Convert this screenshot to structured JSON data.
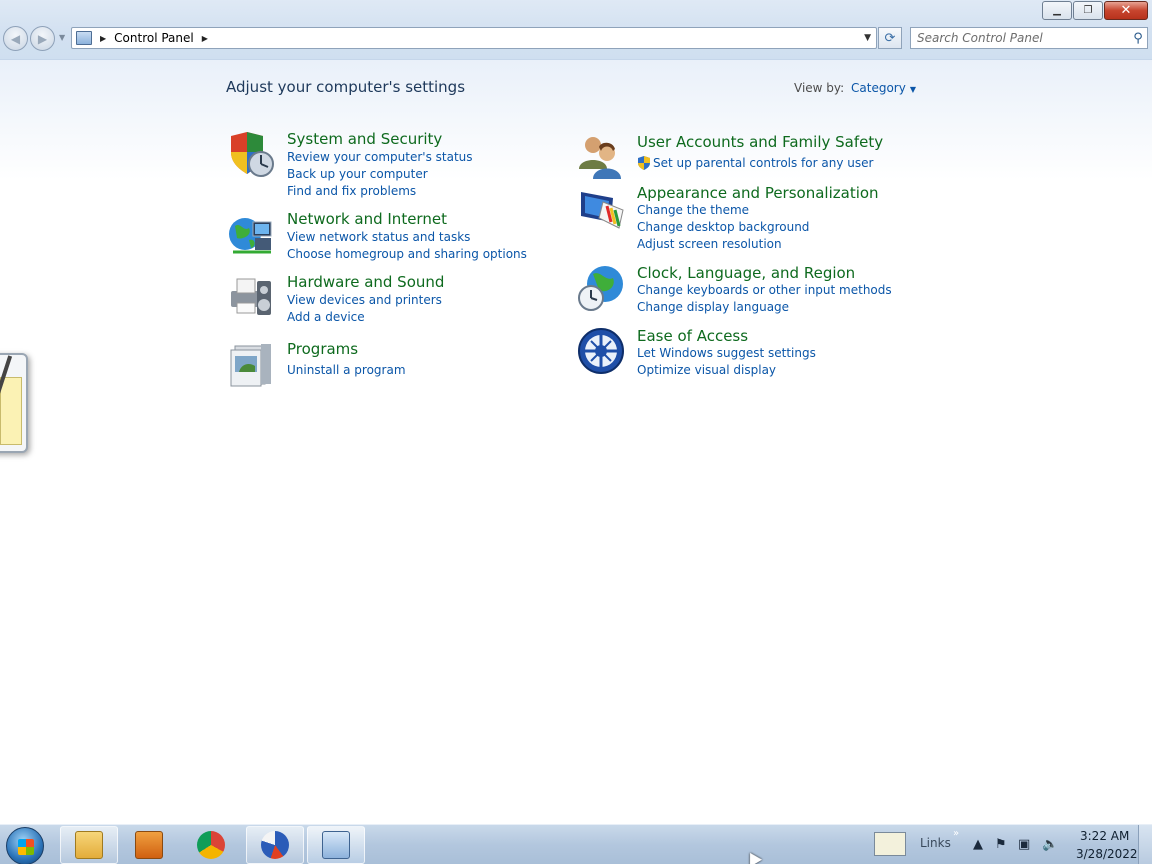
{
  "window": {
    "minimize_icon": "minimize-icon",
    "restore_icon": "restore-icon",
    "close_icon": "close-icon"
  },
  "address_bar": {
    "root_icon": "control-panel-icon",
    "path": "Control Panel"
  },
  "search": {
    "placeholder": "Search Control Panel"
  },
  "page": {
    "title": "Adjust your computer's settings",
    "view_by_label": "View by:",
    "view_by_value": "Category"
  },
  "categories": [
    {
      "title": "System and Security",
      "icon": "shield-clock-icon",
      "links": [
        "Review your computer's status",
        "Back up your computer",
        "Find and fix problems"
      ]
    },
    {
      "title": "Network and Internet",
      "icon": "globe-network-icon",
      "links": [
        "View network status and tasks",
        "Choose homegroup and sharing options"
      ]
    },
    {
      "title": "Hardware and Sound",
      "icon": "printer-speaker-icon",
      "links": [
        "View devices and printers",
        "Add a device"
      ]
    },
    {
      "title": "Programs",
      "icon": "programs-icon",
      "links": [
        "Uninstall a program"
      ]
    },
    {
      "title": "User Accounts and Family Safety",
      "icon": "users-icon",
      "links": [
        "Set up parental controls for any user"
      ]
    },
    {
      "title": "Appearance and Personalization",
      "icon": "display-brush-icon",
      "links": [
        "Change the theme",
        "Change desktop background",
        "Adjust screen resolution"
      ]
    },
    {
      "title": "Clock, Language, and Region",
      "icon": "globe-clock-icon",
      "links": [
        "Change keyboards or other input methods",
        "Change display language"
      ]
    },
    {
      "title": "Ease of Access",
      "icon": "ease-of-access-icon",
      "links": [
        "Let Windows suggest settings",
        "Optimize visual display"
      ]
    }
  ],
  "taskbar": {
    "links_label": "Links",
    "clock_time": "3:22 AM",
    "clock_date": "3/28/2022",
    "items": [
      "file-explorer-icon",
      "media-player-icon",
      "chrome-icon",
      "app-icon",
      "control-panel-icon"
    ]
  },
  "colors": {
    "category_title": "#0e6a1e",
    "link": "#0b56a8",
    "page_title": "#1e395b"
  }
}
